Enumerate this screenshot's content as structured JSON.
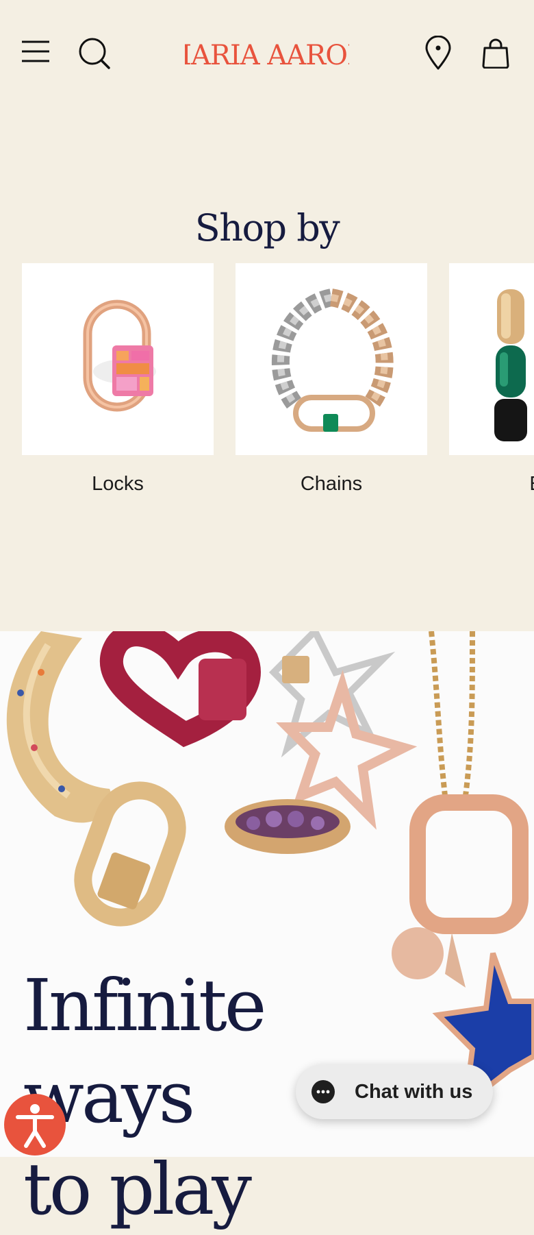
{
  "header": {
    "logo_text": "MARIA AARON",
    "icons": [
      "menu-icon",
      "search-icon",
      "location-pin-icon",
      "shopping-bag-icon"
    ]
  },
  "shop": {
    "title": "Shop by",
    "categories": [
      {
        "label": "Locks",
        "image": "lock-pendant-image"
      },
      {
        "label": "Chains",
        "image": "chain-bracelet-image"
      },
      {
        "label": "Ear",
        "image": "earring-image"
      }
    ]
  },
  "hero": {
    "title_line1": "Infinite ways",
    "title_line2": "to play"
  },
  "chat": {
    "label": "Chat with us"
  },
  "accessibility": {
    "icon": "accessibility-icon"
  },
  "colors": {
    "background": "#f4efe3",
    "brand": "#e8533d",
    "navy": "#161b3f",
    "chat_bg": "#ececec"
  }
}
